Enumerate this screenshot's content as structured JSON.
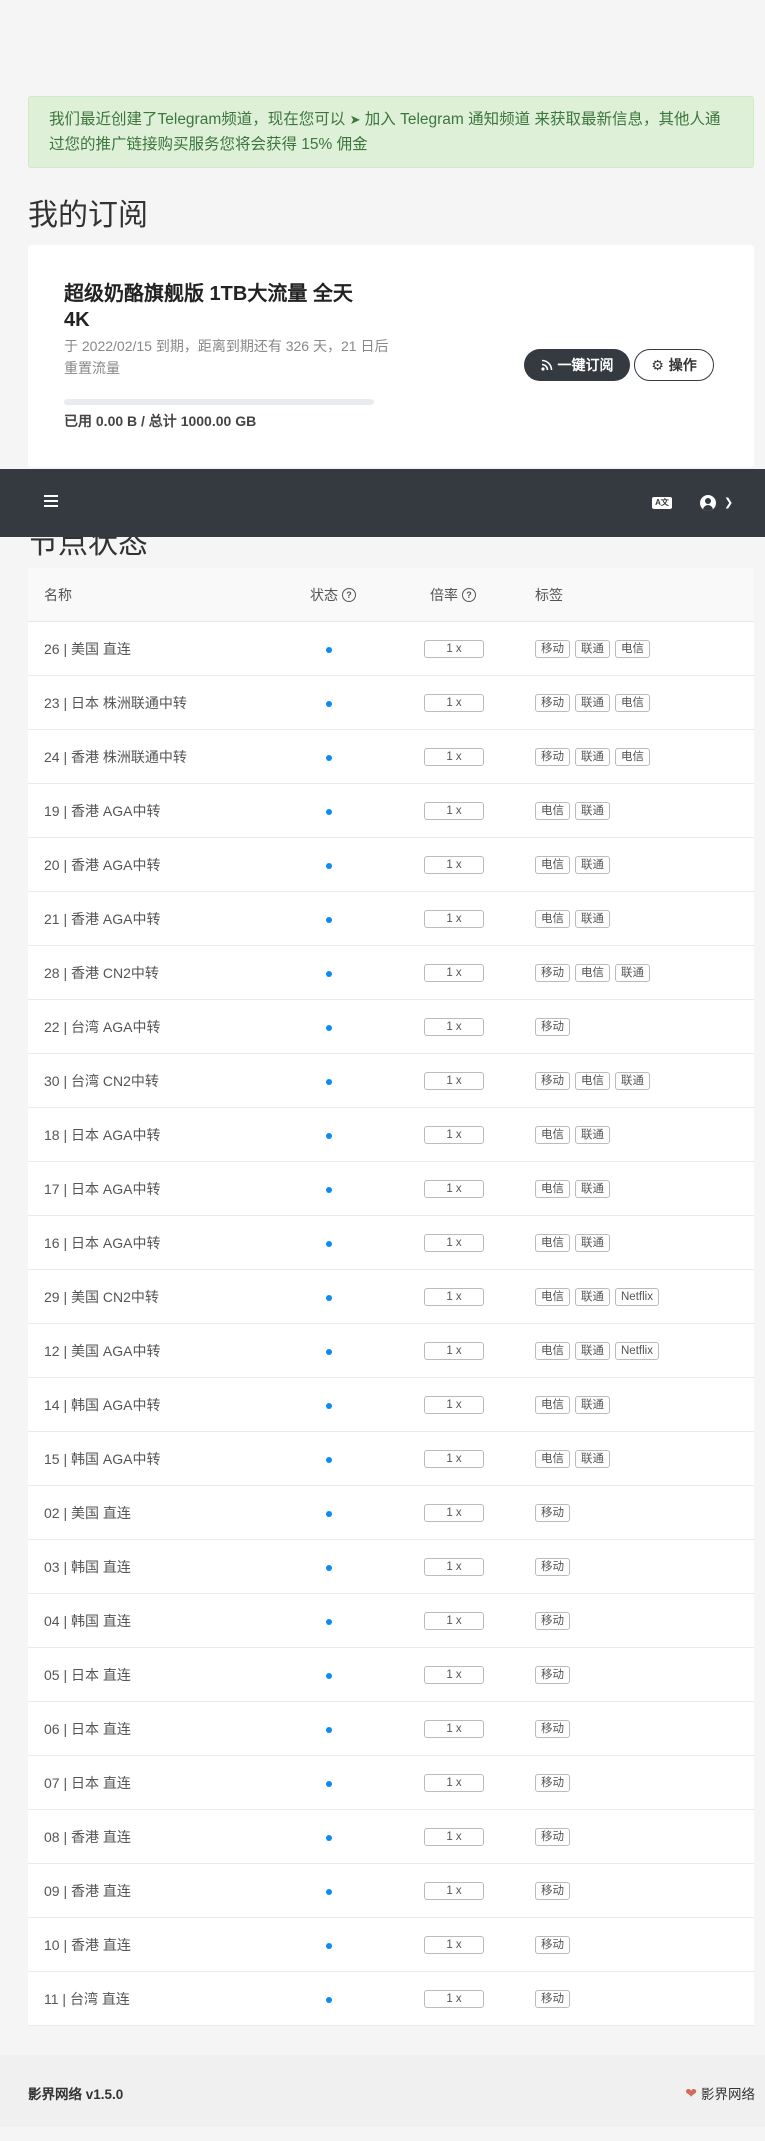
{
  "alert": {
    "text_before": "我们最近创建了Telegram频道，现在您可以",
    "telegram_icon": "paper-plane-icon",
    "link_text": "加入 Telegram 通知频道",
    "text_after": " 来获取最新信息，其他人通过您的推广链接购买服务您将会获得 15% 佣金"
  },
  "subscription": {
    "section_title": "我的订阅",
    "plan_name": "超级奶酪旗舰版 1TB大流量 全天4K",
    "desc": "于 2022/02/15 到期，距离到期还有 326 天，21 日后重置流量",
    "usage_text": "已用 0.00 B / 总计 1000.00 GB",
    "usage_fraction": 0,
    "subscribe_button": "一键订阅",
    "action_button": "操作"
  },
  "navbar": {
    "menu_icon": "hamburger-menu-icon",
    "lang_icon": "translate-icon",
    "user_icon": "user-circle-icon",
    "caret_icon": "chevron-down-icon"
  },
  "nodes": {
    "section_title": "节点状态",
    "headers": {
      "name": "名称",
      "status": "状态",
      "rate": "倍率",
      "tags": "标签"
    },
    "rows": [
      {
        "name": "26 | 美国 直连",
        "rate": "1 x",
        "tags": [
          "移动",
          "联通",
          "电信"
        ]
      },
      {
        "name": "23 | 日本 株洲联通中转",
        "rate": "1 x",
        "tags": [
          "移动",
          "联通",
          "电信"
        ]
      },
      {
        "name": "24 | 香港 株洲联通中转",
        "rate": "1 x",
        "tags": [
          "移动",
          "联通",
          "电信"
        ]
      },
      {
        "name": "19 | 香港 AGA中转",
        "rate": "1 x",
        "tags": [
          "电信",
          "联通"
        ]
      },
      {
        "name": "20 | 香港 AGA中转",
        "rate": "1 x",
        "tags": [
          "电信",
          "联通"
        ]
      },
      {
        "name": "21 | 香港 AGA中转",
        "rate": "1 x",
        "tags": [
          "电信",
          "联通"
        ]
      },
      {
        "name": "28 | 香港 CN2中转",
        "rate": "1 x",
        "tags": [
          "移动",
          "电信",
          "联通"
        ]
      },
      {
        "name": "22 | 台湾 AGA中转",
        "rate": "1 x",
        "tags": [
          "移动"
        ]
      },
      {
        "name": "30 | 台湾 CN2中转",
        "rate": "1 x",
        "tags": [
          "移动",
          "电信",
          "联通"
        ]
      },
      {
        "name": "18 | 日本 AGA中转",
        "rate": "1 x",
        "tags": [
          "电信",
          "联通"
        ]
      },
      {
        "name": "17 | 日本 AGA中转",
        "rate": "1 x",
        "tags": [
          "电信",
          "联通"
        ]
      },
      {
        "name": "16 | 日本 AGA中转",
        "rate": "1 x",
        "tags": [
          "电信",
          "联通"
        ]
      },
      {
        "name": "29 | 美国 CN2中转",
        "rate": "1 x",
        "tags": [
          "电信",
          "联通",
          "Netflix"
        ]
      },
      {
        "name": "12 | 美国 AGA中转",
        "rate": "1 x",
        "tags": [
          "电信",
          "联通",
          "Netflix"
        ]
      },
      {
        "name": "14 | 韩国 AGA中转",
        "rate": "1 x",
        "tags": [
          "电信",
          "联通"
        ]
      },
      {
        "name": "15 | 韩国 AGA中转",
        "rate": "1 x",
        "tags": [
          "电信",
          "联通"
        ]
      },
      {
        "name": "02 | 美国 直连",
        "rate": "1 x",
        "tags": [
          "移动"
        ]
      },
      {
        "name": "03 | 韩国 直连",
        "rate": "1 x",
        "tags": [
          "移动"
        ]
      },
      {
        "name": "04 | 韩国 直连",
        "rate": "1 x",
        "tags": [
          "移动"
        ]
      },
      {
        "name": "05 | 日本 直连",
        "rate": "1 x",
        "tags": [
          "移动"
        ]
      },
      {
        "name": "06 | 日本 直连",
        "rate": "1 x",
        "tags": [
          "移动"
        ]
      },
      {
        "name": "07 | 日本 直连",
        "rate": "1 x",
        "tags": [
          "移动"
        ]
      },
      {
        "name": "08 | 香港 直连",
        "rate": "1 x",
        "tags": [
          "移动"
        ]
      },
      {
        "name": "09 | 香港 直连",
        "rate": "1 x",
        "tags": [
          "移动"
        ]
      },
      {
        "name": "10 | 香港 直连",
        "rate": "1 x",
        "tags": [
          "移动"
        ]
      },
      {
        "name": "11 | 台湾 直连",
        "rate": "1 x",
        "tags": [
          "移动"
        ]
      }
    ]
  },
  "footer": {
    "version": "影界网络 v1.5.0",
    "brand": "影界网络",
    "heart_icon": "heart-icon"
  }
}
